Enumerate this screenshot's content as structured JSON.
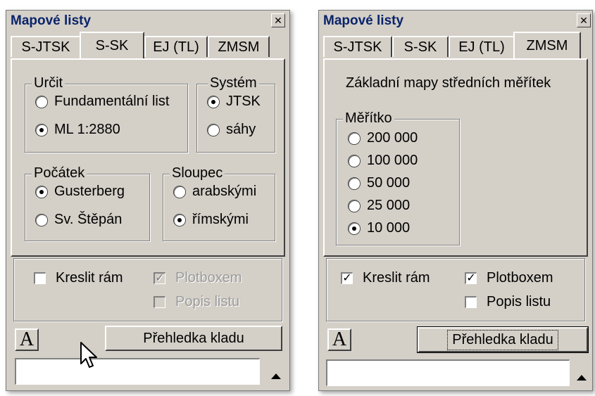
{
  "left_panel": {
    "title": "Mapové listy",
    "close_glyph": "✕",
    "tabs": [
      {
        "label": "S-JTSK",
        "active": false
      },
      {
        "label": "S-SK",
        "active": true
      },
      {
        "label": "EJ (TL)",
        "active": false
      },
      {
        "label": "ZMSM",
        "active": false
      }
    ],
    "urcit": {
      "legend": "Určit",
      "options": [
        {
          "label": "Fundamentální list",
          "selected": false
        },
        {
          "label": "ML 1:2880",
          "selected": true
        }
      ]
    },
    "system": {
      "legend": "Systém",
      "options": [
        {
          "label": "JTSK",
          "selected": true
        },
        {
          "label": "sáhy",
          "selected": false
        }
      ]
    },
    "pocatek": {
      "legend": "Počátek",
      "options": [
        {
          "label": "Gusterberg",
          "selected": true
        },
        {
          "label": "Sv. Štěpán",
          "selected": false
        }
      ]
    },
    "sloupec": {
      "legend": "Sloupec",
      "options": [
        {
          "label": "arabskými",
          "selected": false
        },
        {
          "label": "římskými",
          "selected": true
        }
      ]
    },
    "checks": {
      "kreslit_ram": {
        "label": "Kreslit rám",
        "checked": false,
        "enabled": true
      },
      "plotboxem": {
        "label": "Plotboxem",
        "checked": true,
        "enabled": false
      },
      "popis_listu": {
        "label": "Popis listu",
        "checked": false,
        "enabled": false
      }
    },
    "font_button": "A",
    "overview_button": "Přehledka kladu",
    "input_value": ""
  },
  "right_panel": {
    "title": "Mapové listy",
    "close_glyph": "✕",
    "tabs": [
      {
        "label": "S-JTSK",
        "active": false
      },
      {
        "label": "S-SK",
        "active": false
      },
      {
        "label": "EJ (TL)",
        "active": false
      },
      {
        "label": "ZMSM",
        "active": true
      }
    ],
    "heading": "Základní mapy středních měřítek",
    "meritko": {
      "legend": "Měřítko",
      "options": [
        {
          "label": "200 000",
          "selected": false
        },
        {
          "label": "100 000",
          "selected": false
        },
        {
          "label": "50 000",
          "selected": false
        },
        {
          "label": "25 000",
          "selected": false
        },
        {
          "label": "10 000",
          "selected": true
        }
      ]
    },
    "checks": {
      "kreslit_ram": {
        "label": "Kreslit rám",
        "checked": true,
        "enabled": true
      },
      "plotboxem": {
        "label": "Plotboxem",
        "checked": true,
        "enabled": true
      },
      "popis_listu": {
        "label": "Popis listu",
        "checked": false,
        "enabled": true
      }
    },
    "font_button": "A",
    "overview_button": "Přehledka kladu",
    "input_value": ""
  },
  "colors": {
    "face": "#d4d0c8",
    "title_text": "#0a246a",
    "disabled_text": "#9b9b9b"
  }
}
